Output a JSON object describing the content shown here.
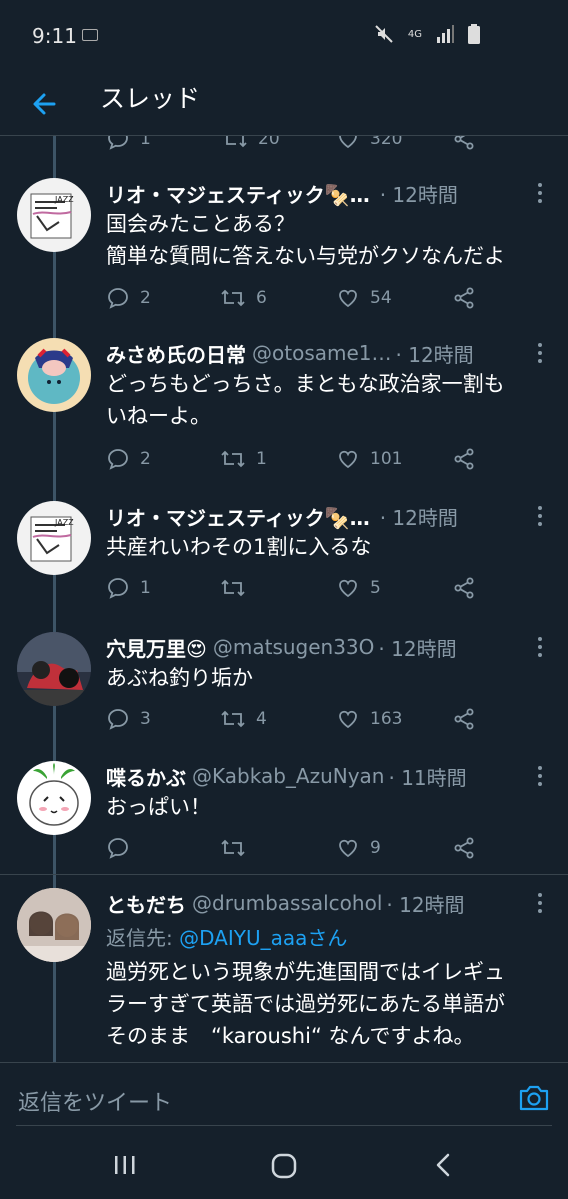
{
  "status": {
    "time": "9:11",
    "network": "4G"
  },
  "header": {
    "title": "スレッド"
  },
  "partial_counts": {
    "reply": "1",
    "retweet": "20",
    "like": "320"
  },
  "tweets": [
    {
      "name": "リオ・マジェスティック🍢…",
      "handle": "",
      "time": "· 12時間",
      "lines": [
        "国会みたことある？",
        "簡単な質問に答えない与党がクソなんだよ"
      ],
      "reply": "2",
      "retweet": "6",
      "like": "54"
    },
    {
      "name": "みさめ氏の日常",
      "handle": "@otosame1…",
      "time": "· 12時間",
      "lines": [
        "どっちもどっちさ。まともな政治家一割も",
        "いねーよ。"
      ],
      "reply": "2",
      "retweet": "1",
      "like": "101"
    },
    {
      "name": "リオ・マジェスティック🍢…",
      "handle": "",
      "time": "· 12時間",
      "lines": [
        "共産れいわその1割に入るな"
      ],
      "reply": "1",
      "retweet": "",
      "like": "5"
    },
    {
      "name": "穴見万里😍",
      "handle": "@matsugen33O",
      "time": "· 12時間",
      "lines": [
        "あぶね釣り垢か"
      ],
      "reply": "3",
      "retweet": "4",
      "like": "163"
    },
    {
      "name": "喋るかぶ",
      "handle": "@Kabkab_AzuNyan",
      "time": "· 11時間",
      "lines": [
        "おっぱい！"
      ],
      "reply": "",
      "retweet": "",
      "like": "9"
    },
    {
      "name": "ともだち",
      "handle": "@drumbassalcohol",
      "time": "· 12時間",
      "reply_prefix": "返信先: ",
      "reply_mention": "@DAIYU_aaaさん",
      "lines": [
        "過労死という現象が先進国間ではイレギュ",
        "ラーすぎて英語では過労死にあたる単語が",
        "そのまま　“karoushi“ なんですよね。"
      ]
    }
  ],
  "reply_bar": {
    "placeholder": "返信をツイート"
  },
  "colors": {
    "background": "#15202b",
    "accent": "#1da1f2",
    "muted": "#8899a6",
    "divider": "#38444d"
  }
}
